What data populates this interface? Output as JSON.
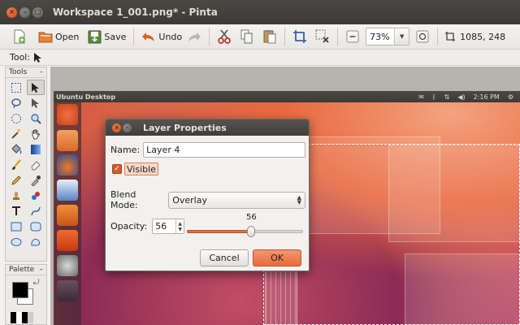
{
  "window": {
    "title": "Workspace 1_001.png* - Pinta"
  },
  "toolbar": {
    "open_label": "Open",
    "save_label": "Save",
    "undo_label": "Undo",
    "zoom_value": "73%",
    "size_readout": "1085, 248"
  },
  "toolrow": {
    "label": "Tool:"
  },
  "tools_panel": {
    "header": "Tools"
  },
  "palette_panel": {
    "header": "Palette"
  },
  "canvas": {
    "topbar_title": "Ubuntu Desktop",
    "clock": "2:16 PM"
  },
  "dialog": {
    "title": "Layer Properties",
    "name_label": "Name:",
    "name_value": "Layer 4",
    "visible_label": "Visible",
    "visible_checked": true,
    "blend_label": "Blend Mode:",
    "blend_value": "Overlay",
    "opacity_label": "Opacity:",
    "opacity_value": "56",
    "opacity_slider_label": "56",
    "opacity_level": 0.56,
    "cancel_label": "Cancel",
    "ok_label": "OK"
  },
  "colors": {
    "accent": "#e66c3c",
    "titlebar": "#3c3b37"
  }
}
